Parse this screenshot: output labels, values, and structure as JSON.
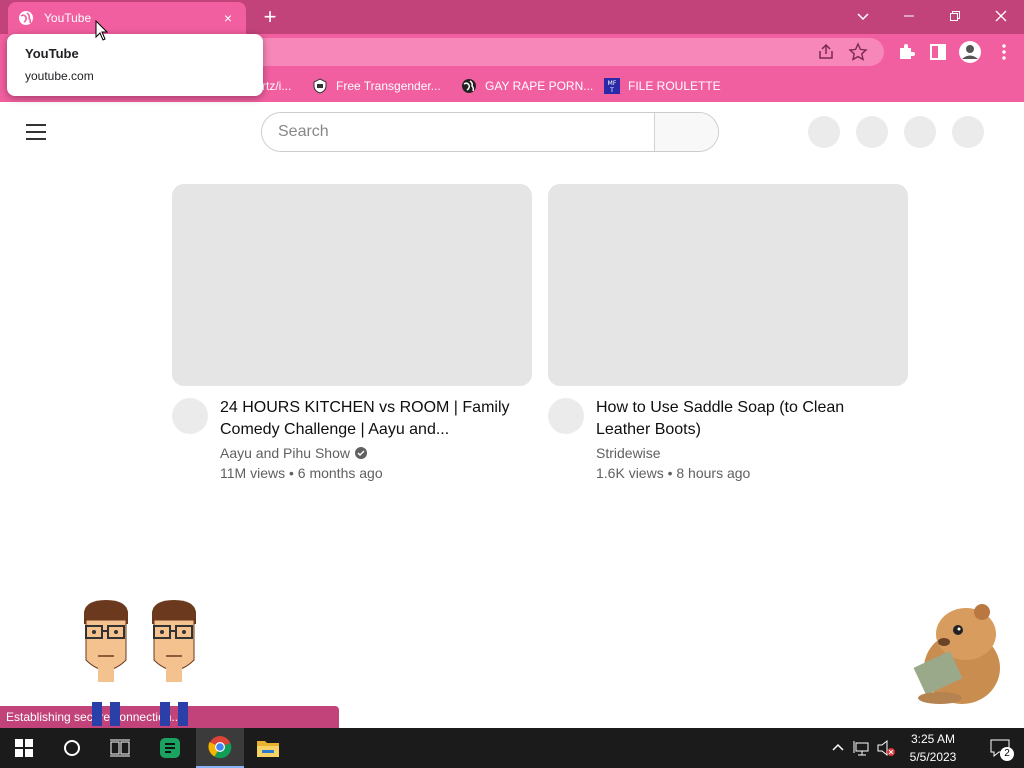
{
  "browser": {
    "tab": {
      "title": "YouTube",
      "close_glyph": "×"
    },
    "new_tab_glyph": "+",
    "window_controls": {
      "dropdown": "⌄",
      "minimize": "—",
      "restore": "❐",
      "close": "✕"
    },
    "tooltip": {
      "title": "YouTube",
      "url": "youtube.com"
    },
    "bookmarks": [
      {
        "label": "rtz/i...",
        "icon": "partial-bookmark"
      },
      {
        "label": "Free Transgender...",
        "icon": "shield-icon"
      },
      {
        "label": "GAY RAPE PORN...",
        "icon": "globe-icon"
      },
      {
        "label": "FILE ROULETTE",
        "icon": "mft-icon"
      }
    ],
    "status_text": "Establishing secure connection..."
  },
  "youtube": {
    "search": {
      "placeholder": "Search"
    },
    "videos": [
      {
        "title": "24 HOURS KITCHEN vs ROOM | Family Comedy Challenge | Aayu and...",
        "channel": "Aayu and Pihu Show",
        "verified": true,
        "stats": "11M views • 6 months ago"
      },
      {
        "title": "How to Use Saddle Soap (to Clean Leather Boots)",
        "channel": "Stridewise",
        "verified": false,
        "stats": "1.6K views • 8 hours ago"
      }
    ]
  },
  "taskbar": {
    "clock": {
      "time": "3:25 AM",
      "date": "5/5/2023"
    },
    "notification_count": "2",
    "apps": [
      "start-icon",
      "search-circle-icon",
      "task-view-icon",
      "sheets-icon",
      "chrome-icon",
      "file-explorer-icon"
    ]
  },
  "colors": {
    "chrome_dark": "#c2437a",
    "chrome_light": "#f25fa0",
    "placeholder_grey": "#e5e5e5",
    "taskbar": "#1b1b1b"
  }
}
